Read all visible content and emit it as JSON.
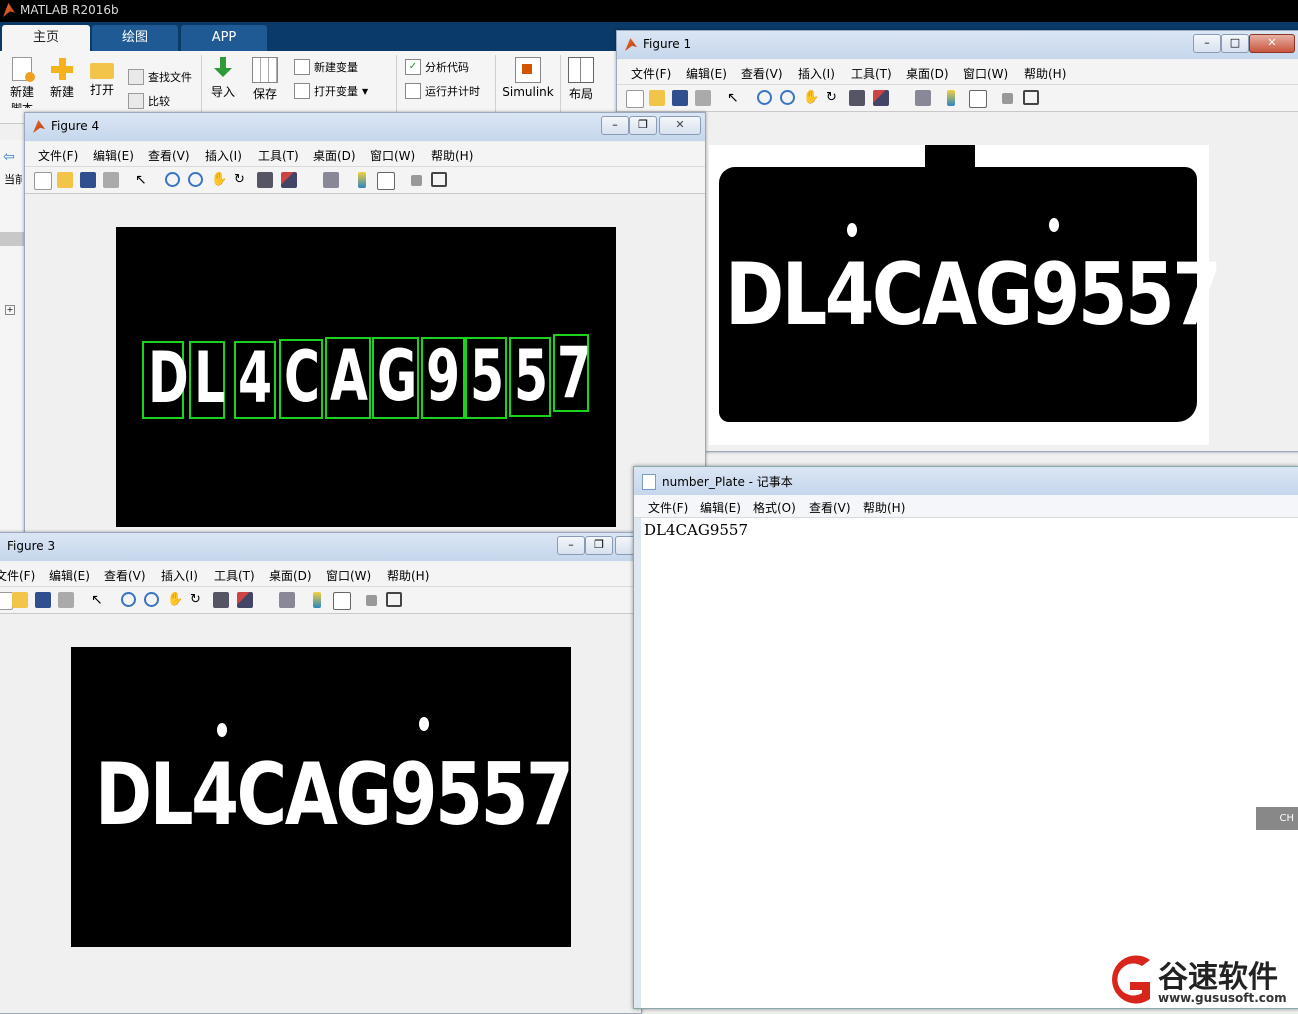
{
  "matlab": {
    "title": "MATLAB R2016b",
    "tabs": [
      "主页",
      "绘图",
      "APP"
    ],
    "ribbon": {
      "new_script": "新建",
      "new_script_2": "脚本",
      "new": "新建",
      "open": "打开",
      "find_files": "查找文件",
      "compare": "比较",
      "import": "导入",
      "save": "保存",
      "new_variable": "新建变量",
      "open_variable": "打开变量",
      "analyze_code": "分析代码",
      "run_and_time": "运行并计时",
      "simulink": "Simulink",
      "layout": "布局"
    },
    "side_label": "当前"
  },
  "figure1": {
    "title": "Figure 1",
    "menu": [
      "文件(F)",
      "编辑(E)",
      "查看(V)",
      "插入(I)",
      "工具(T)",
      "桌面(D)",
      "窗口(W)",
      "帮助(H)"
    ],
    "plate_text": "DL4CAG9557"
  },
  "figure4": {
    "title": "Figure 4",
    "menu": [
      "文件(F)",
      "编辑(E)",
      "查看(V)",
      "插入(I)",
      "工具(T)",
      "桌面(D)",
      "窗口(W)",
      "帮助(H)"
    ],
    "characters": [
      "D",
      "L",
      "4",
      "C",
      "A",
      "G",
      "9",
      "5",
      "5",
      "7"
    ]
  },
  "figure3": {
    "title": "Figure 3",
    "menu": [
      "文件(F)",
      "编辑(E)",
      "查看(V)",
      "插入(I)",
      "工具(T)",
      "桌面(D)",
      "窗口(W)",
      "帮助(H)"
    ],
    "plate_text": "DL4CAG9557"
  },
  "notepad": {
    "title": "number_Plate - 记事本",
    "menu": [
      "文件(F)",
      "编辑(E)",
      "格式(O)",
      "查看(V)",
      "帮助(H)"
    ],
    "content": "DL4CAG9557"
  },
  "ime_indicator": "CH",
  "brand": {
    "name": "谷速软件",
    "url": "www.gususoft.com"
  },
  "colors": {
    "matlab_tabbar": "#0a3a68",
    "box_green": "#1bd31b",
    "brand_red": "#d9261c"
  }
}
